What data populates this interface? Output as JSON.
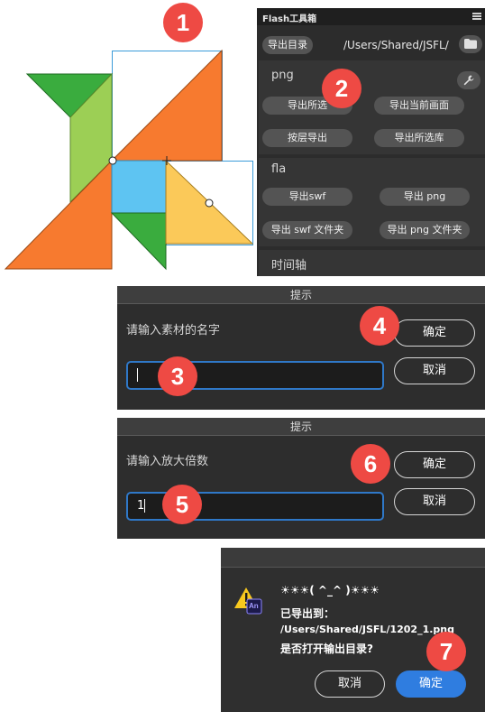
{
  "badges": [
    "1",
    "2",
    "3",
    "4",
    "5",
    "6",
    "7"
  ],
  "toolbox": {
    "title": "Flash工具箱",
    "export_dir_button": "导出目录",
    "export_path": "/Users/Shared/JSFL/",
    "png": {
      "label": "png",
      "buttons": [
        "导出所选",
        "导出当前画面",
        "按层导出",
        "导出所选库"
      ]
    },
    "fla": {
      "label": "fla",
      "buttons": [
        "导出swf",
        "导出 png",
        "导出 swf 文件夹",
        "导出 png 文件夹"
      ]
    },
    "timeline_label": "时间轴"
  },
  "dialog_name": {
    "title": "提示",
    "prompt": "请输入素材的名字",
    "input_value": "",
    "ok_label": "确定",
    "cancel_label": "取消"
  },
  "dialog_scale": {
    "title": "提示",
    "prompt": "请输入放大倍数",
    "input_value": "1",
    "ok_label": "确定",
    "cancel_label": "取消"
  },
  "dialog_done": {
    "headline": "☀☀☀( ^_^ )☀☀☀",
    "line1": "已导出到：",
    "line2": "/Users/Shared/JSFL/1202_1.png",
    "line3": "是否打开输出目录?",
    "cancel_label": "取消",
    "ok_label": "确定",
    "app_badge": "An"
  },
  "colors": {
    "badge": "#ee4a44",
    "orange": "#f77a2f",
    "green": "#3aac3e",
    "lime": "#9ccf55",
    "sky": "#5ec4f2",
    "yellow": "#fbc959",
    "accent_blue": "#2f7de0"
  }
}
